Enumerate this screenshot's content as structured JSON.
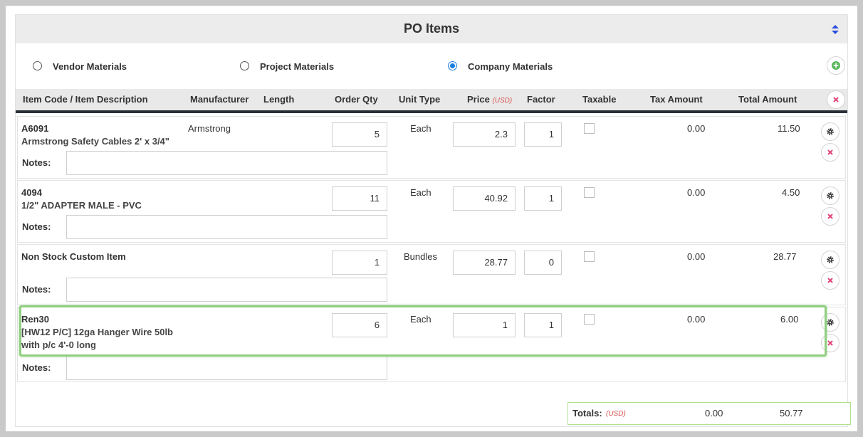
{
  "header": {
    "title": "PO Items"
  },
  "materials": {
    "options": [
      {
        "label": "Vendor Materials",
        "selected": false
      },
      {
        "label": "Project Materials",
        "selected": false
      },
      {
        "label": "Company Materials",
        "selected": true
      }
    ]
  },
  "columns": {
    "item": "Item Code / Item Description",
    "manufacturer": "Manufacturer",
    "length": "Length",
    "order_qty": "Order Qty",
    "unit_type": "Unit Type",
    "price": "Price",
    "price_currency": "(USD)",
    "factor": "Factor",
    "taxable": "Taxable",
    "tax_amount": "Tax Amount",
    "total_amount": "Total Amount"
  },
  "rows": [
    {
      "code": "A6091",
      "description": [
        "Armstrong Safety Cables 2' x 3/4\""
      ],
      "manufacturer": "Armstrong",
      "qty": "5",
      "unit": "Each",
      "price": "2.3",
      "factor": "1",
      "taxable": false,
      "tax": "0.00",
      "total": "11.50",
      "notes_label": "Notes:",
      "notes": ""
    },
    {
      "code": "4094",
      "description": [
        "1/2\" ADAPTER MALE - PVC"
      ],
      "manufacturer": "",
      "qty": "11",
      "unit": "Each",
      "price": "40.92",
      "factor": "1",
      "taxable": false,
      "tax": "0.00",
      "total": "4.50",
      "notes_label": "Notes:",
      "notes": ""
    },
    {
      "code": "Non Stock Custom Item",
      "description": [],
      "manufacturer": "",
      "qty": "1",
      "unit": "Bundles",
      "price": "28.77",
      "factor": "0",
      "taxable": false,
      "tax": "0.00",
      "total": "28.77",
      "notes_label": "Notes:",
      "notes": ""
    },
    {
      "code": "Ren30",
      "description": [
        "[HW12 P/C] 12ga Hanger Wire 50lb",
        "with p/c 4'-0 long"
      ],
      "manufacturer": "",
      "qty": "6",
      "unit": "Each",
      "price": "1",
      "factor": "1",
      "taxable": false,
      "tax": "0.00",
      "total": "6.00",
      "notes_label": "Notes:",
      "notes": ""
    }
  ],
  "totals": {
    "label": "Totals:",
    "currency": "(USD)",
    "tax": "0.00",
    "total": "50.77"
  },
  "colors": {
    "accent": "#1a7ee0",
    "add": "#5cb85c",
    "remove": "#e0447a",
    "highlight": "#90cf80"
  },
  "icons": {
    "sort": "sort-icon",
    "add": "plus-circle-icon",
    "remove": "close-icon",
    "settings": "gear-icon"
  }
}
